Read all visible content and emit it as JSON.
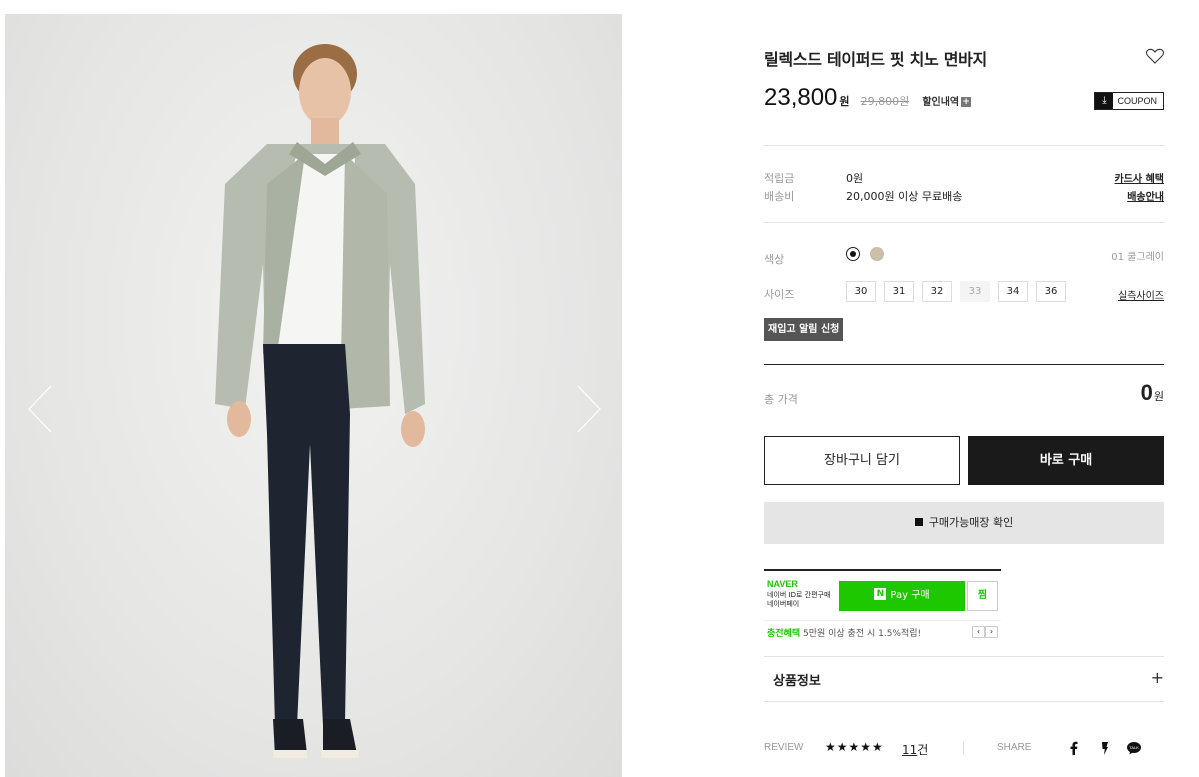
{
  "product": {
    "title": "릴렉스드 테이퍼드 핏 치노 면바지",
    "price": "23,800",
    "price_unit": "원",
    "original_price": "29,800원",
    "discount_label": "할인내역",
    "discount_plus": "+",
    "coupon_label": "COUPON",
    "coupon_icon": "download-icon"
  },
  "meta": {
    "points_label": "적립금",
    "points_value": "0원",
    "shipping_label": "배송비",
    "shipping_value": "20,000원 이상 무료배송",
    "card_benefit_link": "카드사 혜택",
    "shipping_info_link": "배송안내"
  },
  "options": {
    "color_label": "색상",
    "selected_color": "01 쿨그레이",
    "colors": [
      "#111111",
      "#cbbfa6"
    ],
    "size_label": "사이즈",
    "sizes": [
      "30",
      "31",
      "32",
      "33",
      "34",
      "36"
    ],
    "soldout_size": "33",
    "size_guide_link": "실측사이즈",
    "restock_button": "재입고 알림 신청"
  },
  "total": {
    "label": "총 가격",
    "value": "0",
    "unit": "원"
  },
  "actions": {
    "cart_button": "장바구니 담기",
    "buy_button": "바로 구매",
    "store_check_button": "구매가능매장 확인"
  },
  "naver": {
    "logo": "NAVER",
    "desc_line1": "네이버 ID로 간편구매",
    "desc_line2": "네이버페이",
    "pay_n": "N",
    "pay_button": "Pay 구매",
    "wish_button": "찜",
    "benefit_highlight": "충전혜택",
    "benefit_text": " 5만원 이상 충전 시 1.5%적립!",
    "prev": "‹",
    "next": "›"
  },
  "product_info": {
    "label": "상품정보",
    "toggle": "+"
  },
  "review": {
    "label": "REVIEW",
    "stars": "★★★★★",
    "rating": 5,
    "count": "11",
    "count_unit": "건",
    "share_label": "SHARE"
  }
}
